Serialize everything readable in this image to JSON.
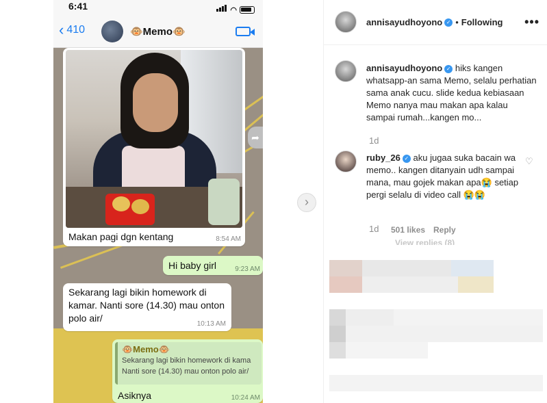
{
  "phone": {
    "status_time": "6:41",
    "back_count": "410",
    "chat_name": "🐵Memo🐵"
  },
  "messages": [
    {
      "text": "Makan pagi dgn kentang",
      "time": "8:54 AM"
    },
    {
      "text": "Hi baby girl",
      "time": "9:23 AM"
    },
    {
      "text": "Sekarang lagi bikin homework di kamar. Nanti sore (14.30) mau onton polo air/",
      "time": "10:13 AM"
    },
    {
      "quote_name": "🐵Memo🐵",
      "quote_line1": "Sekarang lagi bikin homework di kama",
      "quote_line2": "Nanti sore (14.30) mau onton polo air/",
      "text": "Asiknya",
      "time": "10:24 AM"
    }
  ],
  "post": {
    "author": "annisayudhoyono",
    "following_label": "Following",
    "more_label": "•••",
    "caption_user": "annisayudhoyono",
    "caption": "hiks kangen whatsapp-an sama Memo, selalu perhatian sama anak cucu. slide kedua kebiasaan Memo nanya mau makan apa kalau sampai rumah...kangen mo...",
    "caption_age": "1d",
    "comment_user": "ruby_26",
    "comment": "aku jugaa suka bacain wa memo.. kangen ditanyain udh sampai mana, mau gojek makan apa😭 setiap pergi selalu di video call 😭😭",
    "comment_age": "1d",
    "comment_likes": "501 likes",
    "reply_label": "Reply",
    "view_replies": "View replies (8)"
  },
  "icons": {
    "back": "chevron-left-icon",
    "video": "video-call-icon",
    "next": "chevron-right-icon",
    "share": "share-icon",
    "like": "heart-icon",
    "verified": "verified-badge-icon",
    "more": "more-options-icon"
  },
  "colors": {
    "ios_blue": "#1a7cf0",
    "outgoing_bubble": "#dcf8c6",
    "verified_blue": "#3897f0",
    "text_primary": "#262626",
    "text_secondary": "#8e8e8e"
  }
}
